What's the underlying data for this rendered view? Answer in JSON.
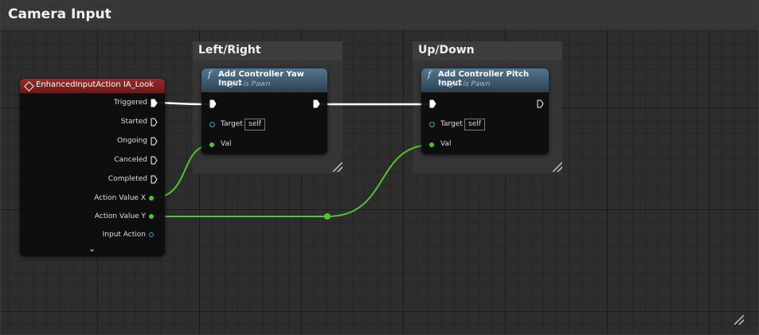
{
  "comment": {
    "title": "Camera Input"
  },
  "groups": [
    {
      "title": "Left/Right"
    },
    {
      "title": "Up/Down"
    }
  ],
  "event_node": {
    "title": "EnhancedInputAction IA_Look",
    "icon": "enhanced-input-diamond-icon",
    "header_color": "#8a2424",
    "pins": {
      "triggered": "Triggered",
      "started": "Started",
      "ongoing": "Ongoing",
      "canceled": "Canceled",
      "completed": "Completed",
      "action_value_x": "Action Value X",
      "action_value_y": "Action Value Y",
      "input_action": "Input Action"
    },
    "expand_icon": "chevron-down-icon"
  },
  "yaw_node": {
    "title": "Add Controller Yaw Input",
    "subtitle": "Target is Pawn",
    "icon_glyph": "f",
    "target_label": "Target",
    "target_value": "self",
    "val_label": "Val"
  },
  "pitch_node": {
    "title": "Add Controller Pitch Input",
    "subtitle": "Target is Pawn",
    "icon_glyph": "f",
    "target_label": "Target",
    "target_value": "self",
    "val_label": "Val"
  },
  "colors": {
    "exec_wire": "#ffffff",
    "float_wire": "#4ec52a",
    "object_pin": "#2fa4d9",
    "function_header": "#3f5a70"
  }
}
